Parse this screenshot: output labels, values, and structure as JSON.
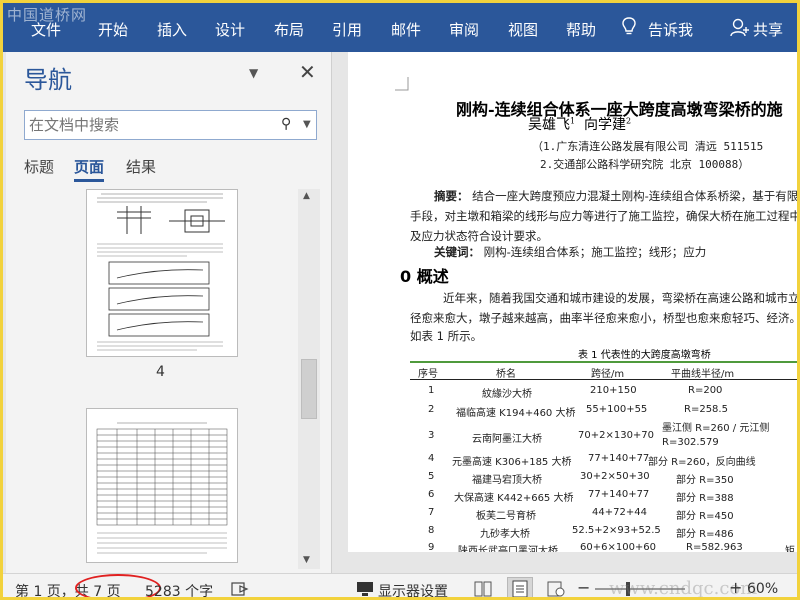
{
  "watermark": "中国道桥网",
  "ribbon": {
    "tabs": [
      "文件",
      "开始",
      "插入",
      "设计",
      "布局",
      "引用",
      "邮件",
      "审阅",
      "视图",
      "帮助"
    ],
    "tell_me": "告诉我",
    "share": "共享",
    "accent": "#2b579a"
  },
  "nav": {
    "title": "导航",
    "search_placeholder": "在文档中搜索",
    "tabs": [
      "标题",
      "页面",
      "结果"
    ],
    "active_tab": "页面",
    "thumb_page_label": "4"
  },
  "doc": {
    "title": "刚构-连续组合体系一座大跨度高墩弯梁桥的施",
    "authors": "吴雄飞",
    "author_sup1": "1",
    "author2": "向学建",
    "author_sup2": "2",
    "affil1": "（1.广东清连公路发展有限公司  清远 511515",
    "affil2": "2.交通部公路科学研究院  北京 100088）",
    "abstract_label": "摘要：",
    "abstract_l1": "结合一座大跨度预应力混凝土刚构-连续组合体系桥梁，基于有限元",
    "abstract_l2": "手段，对主墩和箱梁的线形与应力等进行了施工监控，确保大桥在施工过程中的安",
    "abstract_l3": "及应力状态符合设计要求。",
    "keywords_label": "关键词：",
    "keywords": "刚构-连续组合体系；施工监控；线形；应力",
    "section_num": "0",
    "section_title": "概述",
    "body_l1": "近年来，随着我国交通和城市建设的发展，弯梁桥在高速公路和城市立交桥",
    "body_l2": "径愈来愈大，墩子越来越高，曲率半径愈来愈小，桥型也愈来愈轻巧、经济。代表",
    "body_l3": "如表 1 所示。",
    "table_caption": "表 1  代表性的大跨度高墩弯桥",
    "table_headers": [
      "序号",
      "桥名",
      "跨径/m",
      "平曲线半径/m"
    ],
    "table_rows": [
      [
        "1",
        "紋緣沙大桥",
        "210+150",
        "R=200"
      ],
      [
        "2",
        "福临高速 K194+460 大桥",
        "55+100+55",
        "R=258.5"
      ],
      [
        "3",
        "云南阿墨江大桥",
        "70+2×130+70",
        "墨江侧 R=260 / 元江侧 R=302.579"
      ],
      [
        "4",
        "元墨高速 K306+185 大桥",
        "77+140+77",
        "部分 R=260，反向曲线"
      ],
      [
        "5",
        "福建马宕顶大桥",
        "30+2×50+30",
        "部分 R=350"
      ],
      [
        "6",
        "大保高速 K442+665 大桥",
        "77+140+77",
        "部分 R=388"
      ],
      [
        "7",
        "板芙二号育桥",
        "44+72+44",
        "部分 R=450"
      ],
      [
        "8",
        "九砂孝大桥",
        "52.5+2×93+52.5",
        "部分 R=486"
      ],
      [
        "9",
        "陕西长武亭口黑河大桥",
        "60+6×100+60",
        "R=582.963"
      ]
    ],
    "table_extra_col": "矩"
  },
  "status": {
    "page": "第 1 页，共 7 页",
    "words": "5283 个字",
    "display_settings": "显示器设置",
    "zoom": "60%",
    "watermark": "www.cndqc.com"
  }
}
